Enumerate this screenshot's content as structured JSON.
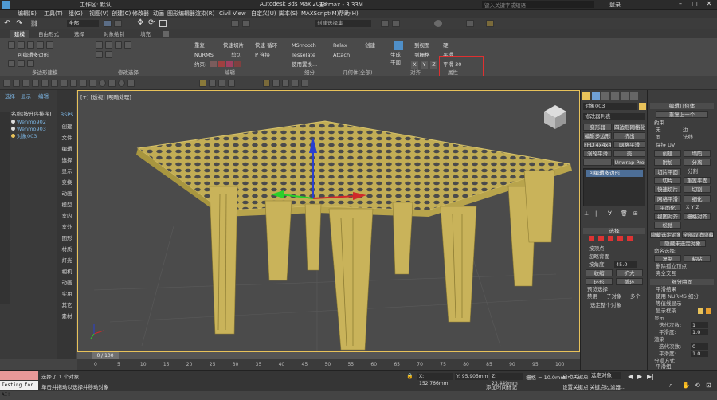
{
  "window": {
    "title": "Autodesk 3ds Max 2018",
    "file": "五-fmax - 3.33M",
    "workspace_label": "工作区: 默认",
    "search_placeholder": "键入关键字或短语",
    "login": "登录"
  },
  "menu": [
    "编辑(E)",
    "工具(T)",
    "组(G)",
    "视图(V)",
    "创建(C)",
    "修改器",
    "动画",
    "图形编辑器",
    "渲染(R)",
    "Civil View",
    "自定义(U)",
    "脚本(S)",
    "MAXScript(M)",
    "帮助(H)"
  ],
  "qat": {
    "selection_filter": "全部",
    "selection_set": "创建选择集"
  },
  "ribbon_tabs": [
    "建模",
    "自由形式",
    "选择",
    "对象绘制",
    "填充"
  ],
  "ribbon": {
    "row1": [
      "重复",
      "快速切片",
      "快速 循环",
      "MSmooth",
      "Relax",
      "创建",
      "到视图",
      "硬"
    ],
    "row2": [
      "NURMS",
      "剪切",
      "P 连接",
      "Tesselate",
      "Attach",
      "到栅格",
      "平滑"
    ],
    "row3": [
      "约束:",
      "使用置换...",
      "X",
      "Y",
      "Z",
      "平滑 30"
    ],
    "generate": "生成\n平面",
    "panel_labels": [
      "多边形建模",
      "修改选择",
      "编辑",
      "细分",
      "几何体(全部)",
      "对齐",
      "属性"
    ],
    "edit_poly_label": "可编辑多边形"
  },
  "scene_explorer": {
    "tabs": [
      "选择",
      "显示",
      "编辑"
    ],
    "header": "名称(按升序排序)",
    "items": [
      "Wenmo902",
      "Wenmo903",
      "对象003"
    ]
  },
  "command_strip": [
    "创建",
    "文件",
    "编辑",
    "选择",
    "显示",
    "变换",
    "动画",
    "模型",
    "室内",
    "室外",
    "图形",
    "材质",
    "灯光",
    "相机",
    "动画",
    "实用",
    "其它",
    "素材"
  ],
  "command_strip_header": "BSPS",
  "viewport": {
    "label": "[+] [透视] [明暗处理]"
  },
  "panel1": {
    "object_name": "对象003",
    "modifier_list": "修改器列表",
    "buttons": [
      [
        "变形器",
        "四边形网格化"
      ],
      [
        "编辑多边形",
        "挤出"
      ],
      [
        "FFD 4x4x4",
        "网格平滑"
      ],
      [
        "涡轮平滑",
        "壳"
      ],
      [
        "",
        "Unwrap Pro"
      ]
    ],
    "stack_item": "可编辑多边形",
    "selection_title": "选择",
    "by_vertex": "按顶点",
    "ignore_backface": "忽略背面",
    "by_angle": "按角度:",
    "angle_value": "45.0",
    "shrink": "收缩",
    "grow": "扩大",
    "ring": "环形",
    "loop": "循环",
    "preview_title": "预览选择",
    "preview_opts": [
      "禁用",
      "子对象",
      "多个"
    ],
    "selected": "选定整个对象"
  },
  "panel2": {
    "title": "编辑几何体",
    "repeat_last": "重复上一个",
    "constraints": "约束",
    "constraint_opts": [
      "无",
      "边",
      "面",
      "法线"
    ],
    "preserve_uv": "保持 UV",
    "create": "创建",
    "collapse": "塌陷",
    "attach": "附加",
    "detach": "分离",
    "slice_plane": "切片平面",
    "split": "分割",
    "slice": "切片",
    "reset_plane": "重置平面",
    "quickslice": "快速切片",
    "cut": "切割",
    "meshsmooth": "网格平滑",
    "tessellate": "细化",
    "make_planar": "平面化",
    "view_align": "视图对齐",
    "grid_align": "栅格对齐",
    "relax": "松弛",
    "hide_sel": "隐藏选定对象",
    "unhide_all": "全部取消隐藏",
    "hide_unsel": "隐藏未选定对象",
    "named_sel": "命名选择:",
    "copy": "复制",
    "paste": "粘贴",
    "delete_iso": "删除孤立顶点",
    "full_interact": "完全交互",
    "subdiv_title": "细分曲面",
    "smooth_result": "平滑结果",
    "use_nurms": "使用 NURMS 细分",
    "iso_display": "等值线显示",
    "show_cage": "显示框架",
    "display": "显示",
    "iterations": "迭代次数:",
    "iter_val": "1",
    "smoothness": "平滑度:",
    "smooth_val": "1.0",
    "render": "渲染",
    "r_iter_val": "0",
    "r_smooth_val": "1.0",
    "separate_by": "分隔方式",
    "smoothing_groups": "平滑组"
  },
  "timeline": {
    "frame": "0 / 100",
    "ticks": [
      "0",
      "5",
      "10",
      "15",
      "20",
      "25",
      "30",
      "35",
      "40",
      "45",
      "50",
      "55",
      "60",
      "65",
      "70",
      "75",
      "80",
      "85",
      "90",
      "95",
      "100"
    ]
  },
  "status": {
    "selected": "选择了 1 个对象",
    "hint": "单击并拖动以选择并移动对象",
    "script_label": "Testing for AI!",
    "x": "X: 152.766mm",
    "y": "Y: 95.905mm",
    "z": "Z: 23.449mm",
    "grid": "栅格 = 10.0mm",
    "auto_key": "自动关键点",
    "set_key": "设置关键点",
    "sel_obj": "选定对象",
    "key_filters": "关键点过滤器...",
    "add_time_tag": "添加时间标记"
  },
  "colors": {
    "accent": "#e8c25a",
    "model": "#c9b35a",
    "highlight": "#e03030"
  }
}
